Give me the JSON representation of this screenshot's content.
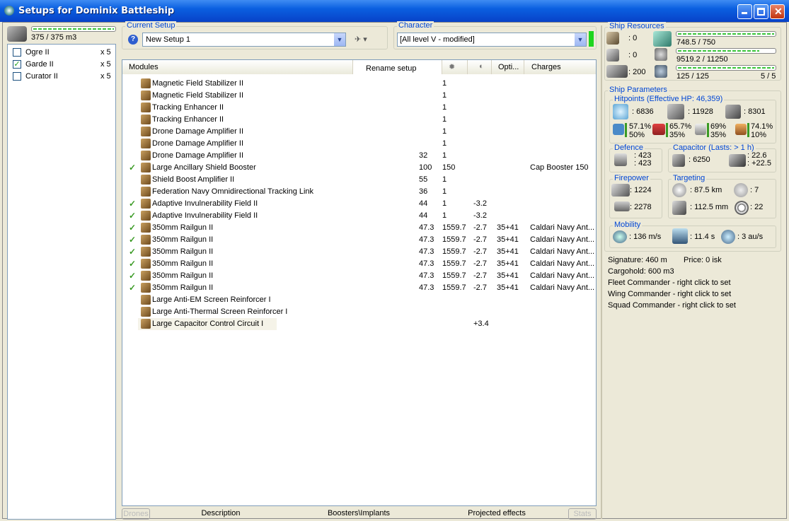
{
  "window": {
    "title": "Setups for Dominix Battleship"
  },
  "drones_panel": {
    "capacity": "375 / 375 m3",
    "items": [
      {
        "name": "Ogre II",
        "count": "x 5",
        "checked": false
      },
      {
        "name": "Garde II",
        "count": "x 5",
        "checked": true
      },
      {
        "name": "Curator II",
        "count": "x 5",
        "checked": false
      }
    ]
  },
  "setup": {
    "group_label": "Current Setup",
    "selected": "New Setup 1",
    "help": "?"
  },
  "character": {
    "group_label": "Character",
    "selected": "[All level V - modified]"
  },
  "modules_header": {
    "modules": "Modules",
    "rename": "Rename setup",
    "opti": "Opti...",
    "charges": "Charges"
  },
  "modules": [
    {
      "name": "Magnetic Field Stabilizer II",
      "cpu": "",
      "pg": "1",
      "dmg": "",
      "opt": "",
      "charge": "",
      "active": false
    },
    {
      "name": "Magnetic Field Stabilizer II",
      "cpu": "",
      "pg": "1",
      "dmg": "",
      "opt": "",
      "charge": "",
      "active": false
    },
    {
      "name": "Tracking Enhancer II",
      "cpu": "",
      "pg": "1",
      "dmg": "",
      "opt": "",
      "charge": "",
      "active": false
    },
    {
      "name": "Tracking Enhancer II",
      "cpu": "",
      "pg": "1",
      "dmg": "",
      "opt": "",
      "charge": "",
      "active": false
    },
    {
      "name": "Drone Damage Amplifier II",
      "cpu": "",
      "pg": "1",
      "dmg": "",
      "opt": "",
      "charge": "",
      "active": false
    },
    {
      "name": "Drone Damage Amplifier II",
      "cpu": "",
      "pg": "1",
      "dmg": "",
      "opt": "",
      "charge": "",
      "active": false
    },
    {
      "name": "Drone Damage Amplifier II",
      "cpu": "32",
      "pg": "1",
      "dmg": "",
      "opt": "",
      "charge": "",
      "active": false
    },
    {
      "name": "Large Ancillary Shield Booster",
      "cpu": "100",
      "pg": "150",
      "dmg": "",
      "opt": "",
      "charge": "Cap Booster 150",
      "active": true
    },
    {
      "name": "Shield Boost Amplifier II",
      "cpu": "55",
      "pg": "1",
      "dmg": "",
      "opt": "",
      "charge": "",
      "active": false
    },
    {
      "name": "Federation Navy Omnidirectional Tracking Link",
      "cpu": "36",
      "pg": "1",
      "dmg": "",
      "opt": "",
      "charge": "",
      "active": false
    },
    {
      "name": "Adaptive Invulnerability Field II",
      "cpu": "44",
      "pg": "1",
      "dmg": "-3.2",
      "opt": "",
      "charge": "",
      "active": true
    },
    {
      "name": "Adaptive Invulnerability Field II",
      "cpu": "44",
      "pg": "1",
      "dmg": "-3.2",
      "opt": "",
      "charge": "",
      "active": true
    },
    {
      "name": "350mm Railgun II",
      "cpu": "47.3",
      "pg": "1559.7",
      "dmg": "-2.7",
      "opt": "35+41",
      "charge": "Caldari Navy Ant...",
      "active": true
    },
    {
      "name": "350mm Railgun II",
      "cpu": "47.3",
      "pg": "1559.7",
      "dmg": "-2.7",
      "opt": "35+41",
      "charge": "Caldari Navy Ant...",
      "active": true
    },
    {
      "name": "350mm Railgun II",
      "cpu": "47.3",
      "pg": "1559.7",
      "dmg": "-2.7",
      "opt": "35+41",
      "charge": "Caldari Navy Ant...",
      "active": true
    },
    {
      "name": "350mm Railgun II",
      "cpu": "47.3",
      "pg": "1559.7",
      "dmg": "-2.7",
      "opt": "35+41",
      "charge": "Caldari Navy Ant...",
      "active": true
    },
    {
      "name": "350mm Railgun II",
      "cpu": "47.3",
      "pg": "1559.7",
      "dmg": "-2.7",
      "opt": "35+41",
      "charge": "Caldari Navy Ant...",
      "active": true
    },
    {
      "name": "350mm Railgun II",
      "cpu": "47.3",
      "pg": "1559.7",
      "dmg": "-2.7",
      "opt": "35+41",
      "charge": "Caldari Navy Ant...",
      "active": true
    },
    {
      "name": "Large Anti-EM Screen Reinforcer I",
      "cpu": "",
      "pg": "",
      "dmg": "",
      "opt": "",
      "charge": "",
      "active": false
    },
    {
      "name": "Large Anti-Thermal Screen Reinforcer I",
      "cpu": "",
      "pg": "",
      "dmg": "",
      "opt": "",
      "charge": "",
      "active": false
    },
    {
      "name": "Large Capacitor Control Circuit I",
      "cpu": "",
      "pg": "",
      "dmg": "+3.4",
      "opt": "",
      "charge": "",
      "active": false
    }
  ],
  "bottom_tabs": [
    "Drones",
    "Description",
    "Boosters\\Implants",
    "Projected effects",
    "Stats"
  ],
  "resources": {
    "label": "Ship Resources",
    "turret": ": 0",
    "launcher": ": 0",
    "drone_bw": ": 200",
    "cpu": "748.5 / 750",
    "cpu_level": 0.998,
    "pg": "9519.2 / 11250",
    "pg_level": 0.846,
    "calib": "125 / 125",
    "calib_level": 1.0,
    "slots": "5 / 5"
  },
  "params": {
    "label": "Ship Parameters",
    "hp": {
      "label": "Hitpoints (Effective HP: 46,359)",
      "shield": ": 6836",
      "armor": ": 11928",
      "structure": ": 8301",
      "res": [
        [
          "57.1%",
          "50%"
        ],
        [
          "65.7%",
          "35%"
        ],
        [
          "69%",
          "35%"
        ],
        [
          "74.1%",
          "10%"
        ]
      ]
    },
    "defence": {
      "label": "Defence",
      "a": ": 423",
      "b": ": 423"
    },
    "capacitor": {
      "label": "Capacitor (Lasts: > 1 h)",
      "cap": ": 6250",
      "a": ": 22.6",
      "b": ": +22.5"
    },
    "firepower": {
      "label": "Firepower",
      "dps": ": 1224",
      "volley": ": 2278"
    },
    "targeting": {
      "label": "Targeting",
      "range": ": 87.5 km",
      "targets": ": 7",
      "res": ": 112.5 mm",
      "sig": ": 22"
    },
    "mobility": {
      "label": "Mobility",
      "speed": ": 136 m/s",
      "align": ": 11.4 s",
      "warp": ": 3 au/s"
    }
  },
  "info": {
    "signature": "Signature: 460 m",
    "price": "Price: 0 isk",
    "cargo": "Cargohold: 600 m3",
    "fleet": "Fleet Commander - right click to set",
    "wing": "Wing Commander - right click to set",
    "squad": "Squad Commander - right click to set"
  }
}
